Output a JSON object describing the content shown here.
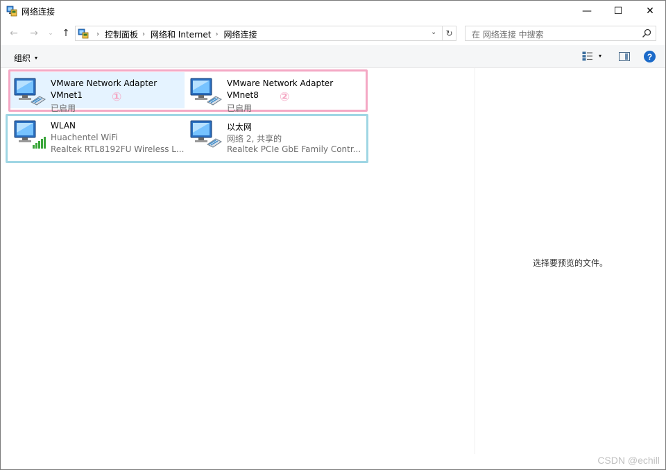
{
  "window": {
    "title": "网络连接"
  },
  "titlebar": {
    "minimize_glyph": "—",
    "maximize_glyph": "☐",
    "close_glyph": "✕"
  },
  "nav": {
    "back_glyph": "←",
    "forward_glyph": "→",
    "recent_glyph": "⌄",
    "up_glyph": "↑",
    "breadcrumbs": [
      "控制面板",
      "网络和 Internet",
      "网络连接"
    ],
    "crumb_sep": "›",
    "dropdown_glyph": "⌄",
    "refresh_glyph": "↻"
  },
  "search": {
    "placeholder": "在 网络连接 中搜索"
  },
  "toolbar": {
    "organize_label": "组织",
    "caret": "▾",
    "help_label": "?"
  },
  "adapters": [
    {
      "name": "VMware Network Adapter",
      "line2": "VMnet1",
      "line3": "已启用",
      "icon": "network-cable-icon",
      "selected": true
    },
    {
      "name": "VMware Network Adapter",
      "line2": "VMnet8",
      "line3": "已启用",
      "icon": "network-cable-icon",
      "selected": false
    },
    {
      "name": "WLAN",
      "line2": "Huachentel WiFi",
      "line3": "Realtek RTL8192FU Wireless L...",
      "icon": "wifi-signal-icon",
      "selected": false
    },
    {
      "name": "以太网",
      "line2": "网络 2, 共享的",
      "line3": "Realtek PCIe GbE Family Contr...",
      "icon": "network-cable-icon",
      "selected": false
    }
  ],
  "annotations": {
    "badge1": "①",
    "badge2": "②"
  },
  "annotation_colors": {
    "pink": "#f4a8c4",
    "cyan": "#9fd6e4"
  },
  "preview": {
    "empty_text": "选择要预览的文件。"
  },
  "watermark": "CSDN @echill"
}
